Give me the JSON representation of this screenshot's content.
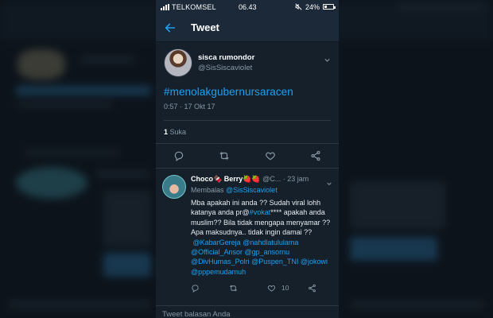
{
  "status_bar": {
    "carrier": "TELKOMSEL",
    "time": "06.43",
    "battery": "24%",
    "signal_icon": "signal-icon",
    "mute_icon": "mute-icon",
    "battery_icon": "battery-icon"
  },
  "app_bar": {
    "title": "Tweet",
    "back_icon": "arrow-left-icon"
  },
  "tweet": {
    "author_name": "sisca rumondor",
    "author_handle": "@SisSiscaviolet",
    "text": "#menolakgubernursaracen",
    "timestamp": "0:57 · 17 Okt 17",
    "likes_count": "1",
    "likes_label": "Suka"
  },
  "reply": {
    "name": "Choco🍫 Berry🍓🍓",
    "handle_time": "@C... · 23 jam",
    "replying_label": "Membalas",
    "replying_to": "@SisSiscaviolet",
    "text_before_link": "Mba apakah ini anda ?? Sudah viral lohh katanya anda pr@",
    "vokat_link": "#vokat",
    "text_after_link": "****  apakah anda muslim?? Bila tidak mengapa menyamar ?? Apa maksudnya.. tidak ingin damai ??",
    "mentions": [
      "@KabarGereja",
      "@nahdlatululama",
      "@Official_Ansor",
      "@gp_ansornu",
      "@DivHumas_Polri",
      "@Puspen_TNI",
      "@jokowi",
      "@pppemudamuh"
    ],
    "like_count": "10"
  },
  "compose": {
    "placeholder": "Tweet balasan Anda"
  },
  "colors": {
    "accent": "#1da1f2",
    "background": "#15202b",
    "muted": "#8899a6"
  }
}
